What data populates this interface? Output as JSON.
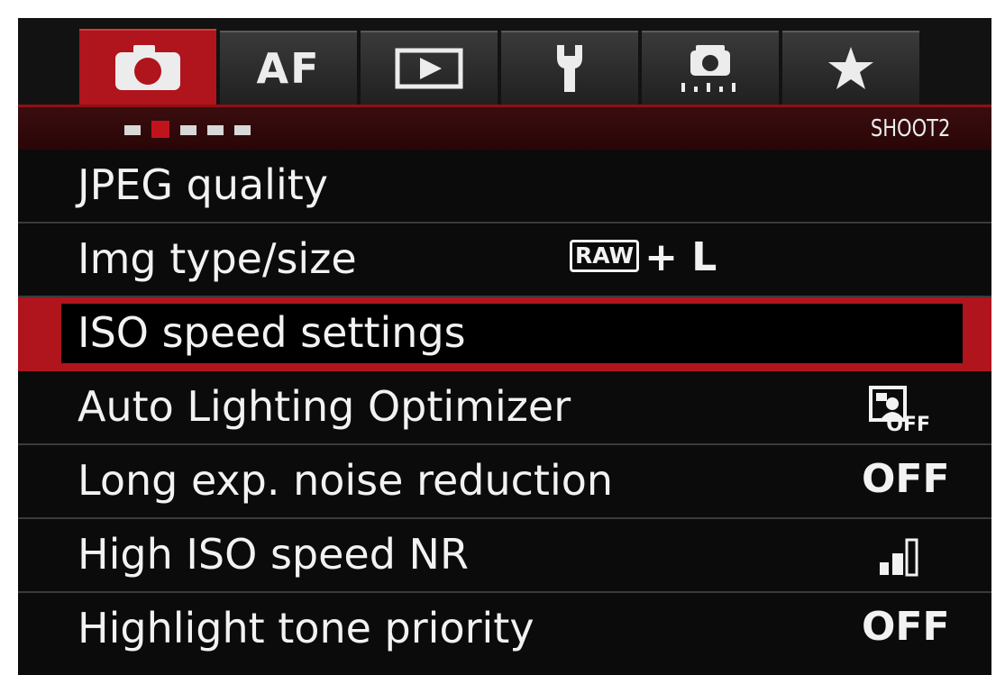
{
  "tabs": [
    {
      "id": "shoot",
      "icon": "camera-icon",
      "label": "",
      "active": true
    },
    {
      "id": "af",
      "icon": "",
      "label": "AF",
      "active": false
    },
    {
      "id": "playback",
      "icon": "playback-icon",
      "label": "",
      "active": false
    },
    {
      "id": "setup",
      "icon": "wrench-icon",
      "label": "",
      "active": false
    },
    {
      "id": "custom",
      "icon": "custom-functions-icon",
      "label": "",
      "active": false
    },
    {
      "id": "mymenu",
      "icon": "star-icon",
      "label": "",
      "active": false
    }
  ],
  "page_indicator": {
    "count": 5,
    "active_index": 1
  },
  "page_name": "SHOOT2",
  "menu_items": [
    {
      "label": "JPEG quality",
      "value": ""
    },
    {
      "label": "Img type/size",
      "value_badge": "RAW",
      "value": "+ L"
    },
    {
      "label": "ISO speed settings",
      "value": "",
      "selected": true
    },
    {
      "label": "Auto Lighting Optimizer",
      "value_icon": "alo-off-icon",
      "value_icon_text": "OFF"
    },
    {
      "label": "Long exp. noise reduction",
      "value": "OFF"
    },
    {
      "label": "High ISO speed NR",
      "value_icon": "nr-level-icon",
      "nr_level": 2
    },
    {
      "label": "Highlight tone priority",
      "value": "OFF"
    }
  ],
  "colors": {
    "accent": "#b0141c",
    "background": "#0b0b0b",
    "text": "#f2f2f2"
  }
}
